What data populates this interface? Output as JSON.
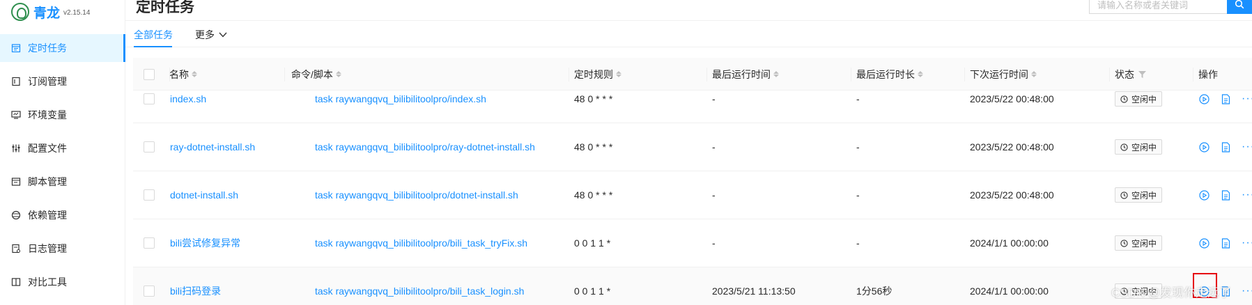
{
  "app": {
    "name": "青龙",
    "version": "v2.15.14"
  },
  "sidebar": {
    "items": [
      {
        "label": "定时任务",
        "icon": "calendar-icon",
        "active": true
      },
      {
        "label": "订阅管理",
        "icon": "subscription-icon",
        "active": false
      },
      {
        "label": "环境变量",
        "icon": "monitor-icon",
        "active": false
      },
      {
        "label": "配置文件",
        "icon": "sliders-icon",
        "active": false
      },
      {
        "label": "脚本管理",
        "icon": "script-icon",
        "active": false
      },
      {
        "label": "依赖管理",
        "icon": "dependency-icon",
        "active": false
      },
      {
        "label": "日志管理",
        "icon": "log-icon",
        "active": false
      },
      {
        "label": "对比工具",
        "icon": "diff-icon",
        "active": false
      }
    ]
  },
  "header": {
    "title": "定时任务",
    "search_placeholder": "请输入名称或者关键词"
  },
  "tabs": {
    "all": "全部任务",
    "more": "更多"
  },
  "table": {
    "columns": {
      "name": "名称",
      "command": "命令/脚本",
      "schedule": "定时规则",
      "last_run_time": "最后运行时间",
      "last_run_duration": "最后运行时长",
      "next_run_time": "下次运行时间",
      "status": "状态",
      "actions": "操作"
    },
    "rows": [
      {
        "name": "index.sh",
        "command": "task raywangqvq_bilibilitoolpro/index.sh",
        "schedule": "48 0 * * *",
        "last_run_time": "-",
        "last_run_duration": "-",
        "next_run_time": "2023/5/22 00:48:00",
        "status": "空闲中"
      },
      {
        "name": "ray-dotnet-install.sh",
        "command": "task raywangqvq_bilibilitoolpro/ray-dotnet-install.sh",
        "schedule": "48 0 * * *",
        "last_run_time": "-",
        "last_run_duration": "-",
        "next_run_time": "2023/5/22 00:48:00",
        "status": "空闲中"
      },
      {
        "name": "dotnet-install.sh",
        "command": "task raywangqvq_bilibilitoolpro/dotnet-install.sh",
        "schedule": "48 0 * * *",
        "last_run_time": "-",
        "last_run_duration": "-",
        "next_run_time": "2023/5/22 00:48:00",
        "status": "空闲中"
      },
      {
        "name": "bili尝试修复异常",
        "command": "task raywangqvq_bilibilitoolpro/bili_task_tryFix.sh",
        "schedule": "0 0 1 1 *",
        "last_run_time": "-",
        "last_run_duration": "-",
        "next_run_time": "2024/1/1 00:00:00",
        "status": "空闲中"
      },
      {
        "name": "bili扫码登录",
        "command": "task raywangqvq_bilibilitoolpro/bili_task_login.sh",
        "schedule": "0 0 1 1 *",
        "last_run_time": "2023/5/21 11:13:50",
        "last_run_duration": "1分56秒",
        "next_run_time": "2024/1/1 00:00:00",
        "status": "空闲中"
      }
    ]
  },
  "watermark": "CSDN @发现你走远了",
  "colors": {
    "primary": "#1890ff",
    "highlight": "#e60012",
    "logo": "#2f8f4e"
  }
}
